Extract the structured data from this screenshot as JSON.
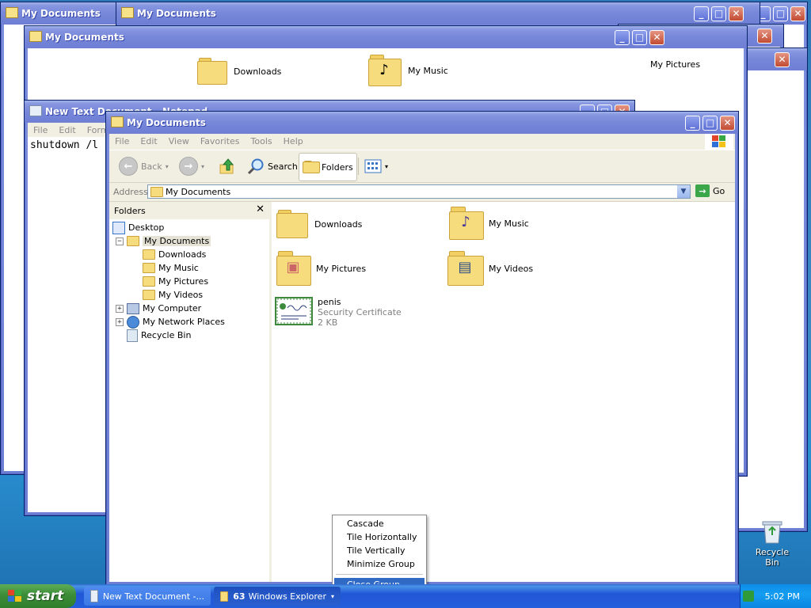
{
  "desktop": {
    "recycle_bin_label": "Recycle Bin"
  },
  "background_windows": [
    {
      "title": "My Documents"
    },
    {
      "title": "My Documents"
    },
    {
      "title": "My Documents"
    }
  ],
  "bg_icons": {
    "downloads": "Downloads",
    "my_music": "My Music",
    "my_pictures": "My Pictures"
  },
  "notepad": {
    "title": "New Text Document - Notepad",
    "menu": [
      "File",
      "Edit",
      "Format"
    ],
    "text": "shutdown /l"
  },
  "explorer": {
    "title": "My Documents",
    "menu": [
      "File",
      "Edit",
      "View",
      "Favorites",
      "Tools",
      "Help"
    ],
    "toolbar": {
      "back": "Back",
      "search": "Search",
      "folders": "Folders"
    },
    "address": {
      "label": "Address",
      "value": "My Documents",
      "go": "Go"
    },
    "folders_pane": {
      "header": "Folders",
      "tree": [
        {
          "label": "Desktop",
          "level": 0,
          "expander": ""
        },
        {
          "label": "My Documents",
          "level": 1,
          "expander": "−",
          "selected": true
        },
        {
          "label": "Downloads",
          "level": 2,
          "expander": ""
        },
        {
          "label": "My Music",
          "level": 2,
          "expander": ""
        },
        {
          "label": "My Pictures",
          "level": 2,
          "expander": ""
        },
        {
          "label": "My Videos",
          "level": 2,
          "expander": ""
        },
        {
          "label": "My Computer",
          "level": 1,
          "expander": "+"
        },
        {
          "label": "My Network Places",
          "level": 1,
          "expander": "+"
        },
        {
          "label": "Recycle Bin",
          "level": 1,
          "expander": ""
        }
      ]
    },
    "items": [
      {
        "name": "Downloads",
        "icon": "folder-icon"
      },
      {
        "name": "My Music",
        "icon": "music-folder-icon"
      },
      {
        "name": "My Pictures",
        "icon": "pictures-folder-icon"
      },
      {
        "name": "My Videos",
        "icon": "videos-folder-icon"
      }
    ],
    "file": {
      "name": "penis",
      "type": "Security Certificate",
      "size": "2 KB"
    }
  },
  "context_menu": {
    "items": [
      "Cascade",
      "Tile Horizontally",
      "Tile Vertically",
      "Minimize Group",
      "Close Group"
    ],
    "selected": "Close Group"
  },
  "taskbar": {
    "start_label": "start",
    "items": [
      {
        "label": "New Text Document -..."
      },
      {
        "count": "63",
        "label": "Windows Explorer"
      }
    ],
    "clock": "5:02 PM"
  },
  "colors": {
    "titlebar": "#7787d9",
    "selection": "#316ac5",
    "taskbar": "#245edb",
    "start_green": "#3c8c38"
  }
}
